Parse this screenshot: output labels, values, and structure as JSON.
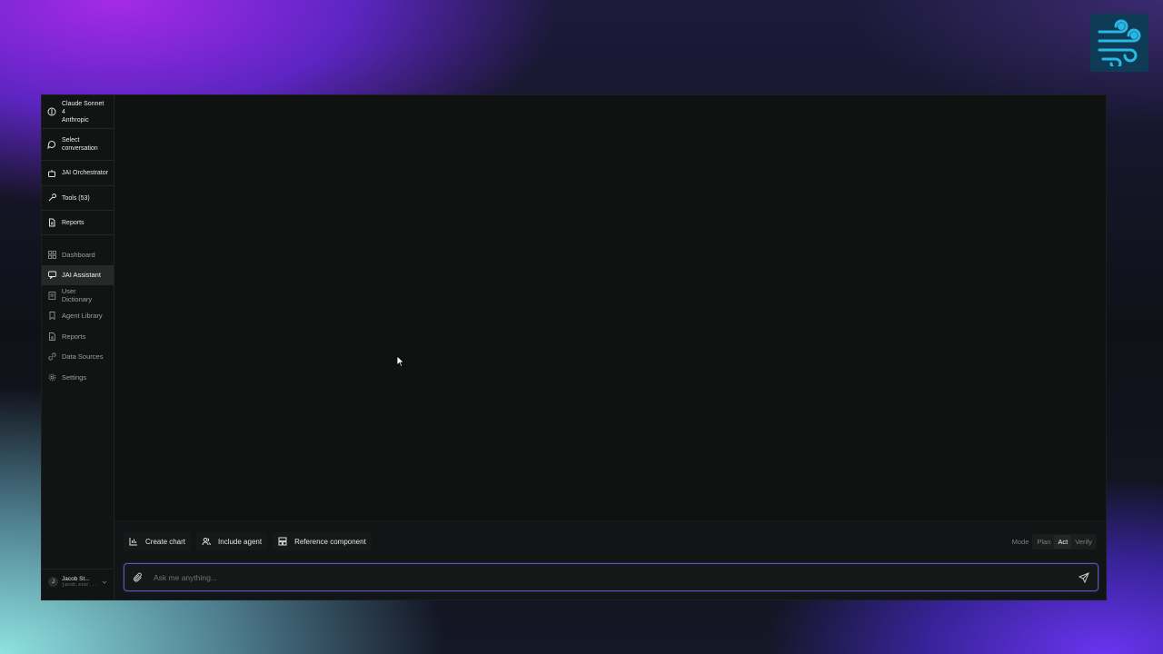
{
  "logo": {
    "icon": "wind-icon",
    "color": "#2bb7e6"
  },
  "sidebar": {
    "top_items": [
      {
        "icon": "model-icon",
        "line1": "Claude Sonnet 4",
        "line2": "Anthropic"
      },
      {
        "icon": "chat-bubble-icon",
        "line1": "Select",
        "line2": "conversation"
      },
      {
        "icon": "robot-icon",
        "line1": "JAI Orchestrator",
        "line2": ""
      },
      {
        "icon": "wrench-icon",
        "line1": "Tools (53)",
        "line2": ""
      },
      {
        "icon": "document-icon",
        "line1": "Reports",
        "line2": ""
      }
    ],
    "nav": [
      {
        "icon": "grid-icon",
        "label": "Dashboard"
      },
      {
        "icon": "chat-icon",
        "label": "JAI Assistant"
      },
      {
        "icon": "book-icon",
        "label": "User Dictionary"
      },
      {
        "icon": "bookmark-icon",
        "label": "Agent Library"
      },
      {
        "icon": "document-icon",
        "label": "Reports"
      },
      {
        "icon": "link-icon",
        "label": "Data Sources"
      },
      {
        "icon": "gear-icon",
        "label": "Settings"
      }
    ],
    "active_nav": "JAI Assistant",
    "user": {
      "initial": "J",
      "name": "Jacob St...",
      "email": "jacob.ster..."
    }
  },
  "composer": {
    "chips": [
      {
        "icon": "bar-chart-icon",
        "label": "Create chart"
      },
      {
        "icon": "users-icon",
        "label": "Include agent"
      },
      {
        "icon": "component-icon",
        "label": "Reference component"
      }
    ],
    "mode_label": "Mode",
    "modes": [
      "Plan",
      "Act",
      "Verify"
    ],
    "active_mode": "Act",
    "placeholder": "Ask me anything...",
    "accent": "#6a4dc4"
  }
}
